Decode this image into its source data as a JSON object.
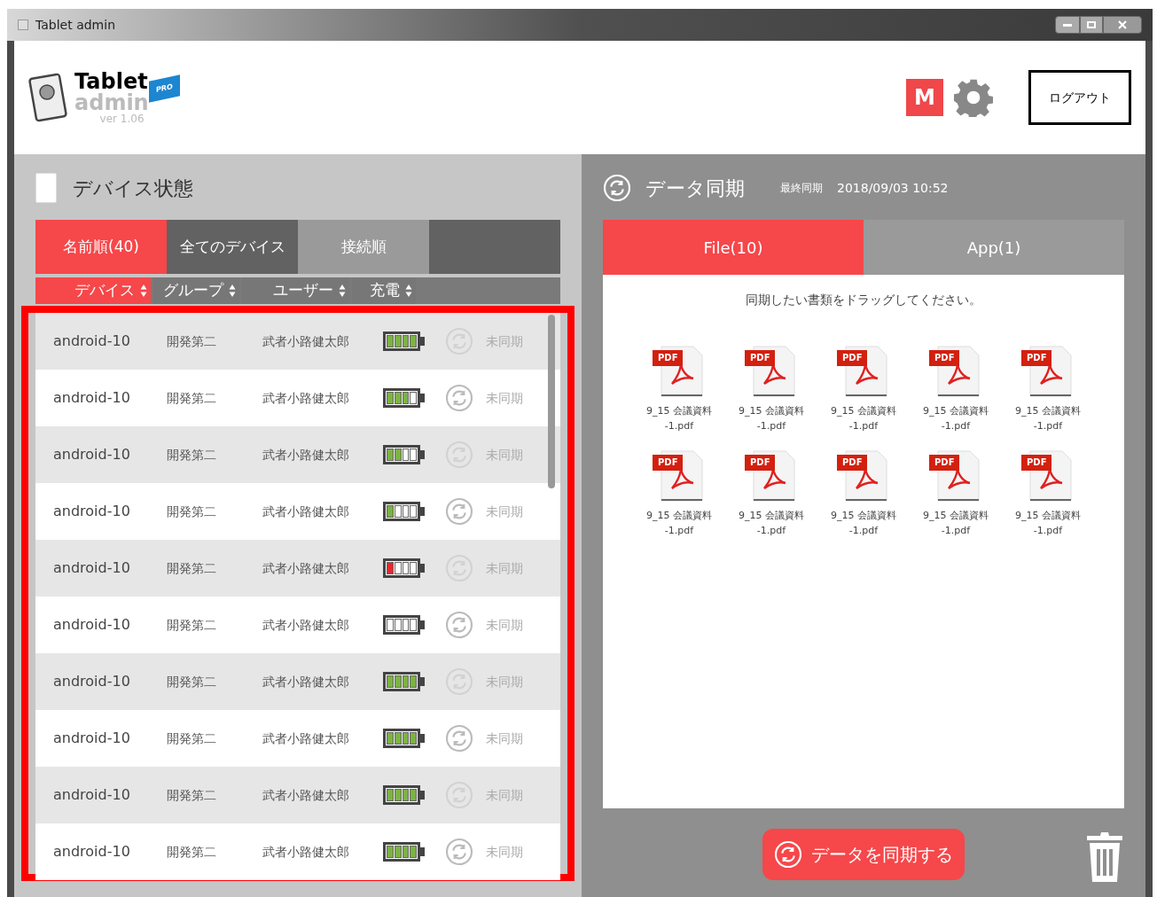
{
  "window": {
    "title": "Tablet admin"
  },
  "header": {
    "logo_line1": "Tablet",
    "logo_line2": "admin",
    "logo_badge": "PRO",
    "version": "ver 1.06",
    "user_badge": "M",
    "logout": "ログアウト"
  },
  "devices": {
    "title": "デバイス状態",
    "tabs": [
      {
        "label": "名前順(40)",
        "selected": true
      },
      {
        "label": "全てのデバイス",
        "selected": false
      },
      {
        "label": "接続順",
        "selected": false
      }
    ],
    "columns": [
      {
        "label": "デバイス",
        "selected": true
      },
      {
        "label": "グループ",
        "selected": false
      },
      {
        "label": "ユーザー",
        "selected": false
      },
      {
        "label": "充電",
        "selected": false
      }
    ],
    "rows": [
      {
        "device": "android-10",
        "group": "開発第二",
        "user": "武者小路健太郎",
        "battery": [
          {
            "on": true
          },
          {
            "on": true
          },
          {
            "on": true
          },
          {
            "on": true
          }
        ],
        "color": "#7cb342",
        "sync": "未同期"
      },
      {
        "device": "android-10",
        "group": "開発第二",
        "user": "武者小路健太郎",
        "battery": [
          {
            "on": true
          },
          {
            "on": true
          },
          {
            "on": true
          },
          {
            "on": false
          }
        ],
        "color": "#7cb342",
        "sync": "未同期"
      },
      {
        "device": "android-10",
        "group": "開発第二",
        "user": "武者小路健太郎",
        "battery": [
          {
            "on": true
          },
          {
            "on": true
          },
          {
            "on": false
          },
          {
            "on": false
          }
        ],
        "color": "#7cb342",
        "sync": "未同期"
      },
      {
        "device": "android-10",
        "group": "開発第二",
        "user": "武者小路健太郎",
        "battery": [
          {
            "on": true
          },
          {
            "on": false
          },
          {
            "on": false
          },
          {
            "on": false
          }
        ],
        "color": "#7cb342",
        "sync": "未同期"
      },
      {
        "device": "android-10",
        "group": "開発第二",
        "user": "武者小路健太郎",
        "battery": [
          {
            "on": true
          },
          {
            "on": false
          },
          {
            "on": false
          },
          {
            "on": false
          }
        ],
        "color": "#e8262f",
        "sync": "未同期"
      },
      {
        "device": "android-10",
        "group": "開発第二",
        "user": "武者小路健太郎",
        "battery": [
          {
            "on": false
          },
          {
            "on": false
          },
          {
            "on": false
          },
          {
            "on": false
          }
        ],
        "sync": "未同期"
      },
      {
        "device": "android-10",
        "group": "開発第二",
        "user": "武者小路健太郎",
        "battery": [
          {
            "on": true
          },
          {
            "on": true
          },
          {
            "on": true
          },
          {
            "on": true
          }
        ],
        "color": "#7cb342",
        "sync": "未同期"
      },
      {
        "device": "android-10",
        "group": "開発第二",
        "user": "武者小路健太郎",
        "battery": [
          {
            "on": true
          },
          {
            "on": true
          },
          {
            "on": true
          },
          {
            "on": true
          }
        ],
        "color": "#7cb342",
        "sync": "未同期"
      },
      {
        "device": "android-10",
        "group": "開発第二",
        "user": "武者小路健太郎",
        "battery": [
          {
            "on": true
          },
          {
            "on": true
          },
          {
            "on": true
          },
          {
            "on": true
          }
        ],
        "color": "#7cb342",
        "sync": "未同期"
      },
      {
        "device": "android-10",
        "group": "開発第二",
        "user": "武者小路健太郎",
        "battery": [
          {
            "on": true
          },
          {
            "on": true
          },
          {
            "on": true
          },
          {
            "on": true
          }
        ],
        "color": "#7cb342",
        "sync": "未同期"
      }
    ]
  },
  "sync": {
    "title": "データ同期",
    "last_label": "最終同期",
    "last_time": "2018/09/03 10:52",
    "tabs": [
      {
        "label": "File(10)",
        "selected": true
      },
      {
        "label": "App(1)",
        "selected": false
      }
    ],
    "hint": "同期したい書類をドラッグしてください。",
    "files": [
      {
        "badge": "PDF",
        "lines": [
          "9_15 会議資料",
          "-1.pdf"
        ]
      },
      {
        "badge": "PDF",
        "lines": [
          "9_15 会議資料",
          "-1.pdf"
        ]
      },
      {
        "badge": "PDF",
        "lines": [
          "9_15 会議資料",
          "-1.pdf"
        ]
      },
      {
        "badge": "PDF",
        "lines": [
          "9_15 会議資料",
          "-1.pdf"
        ]
      },
      {
        "badge": "PDF",
        "lines": [
          "9_15 会議資料",
          "-1.pdf"
        ]
      },
      {
        "badge": "PDF",
        "lines": [
          "9_15 会議資料",
          "-1.pdf"
        ]
      },
      {
        "badge": "PDF",
        "lines": [
          "9_15 会議資料",
          "-1.pdf"
        ]
      },
      {
        "badge": "PDF",
        "lines": [
          "9_15 会議資料",
          "-1.pdf"
        ]
      },
      {
        "badge": "PDF",
        "lines": [
          "9_15 会議資料",
          "-1.pdf"
        ]
      },
      {
        "badge": "PDF",
        "lines": [
          "9_15 会議資料",
          "-1.pdf"
        ]
      }
    ],
    "button": "データを同期する"
  }
}
